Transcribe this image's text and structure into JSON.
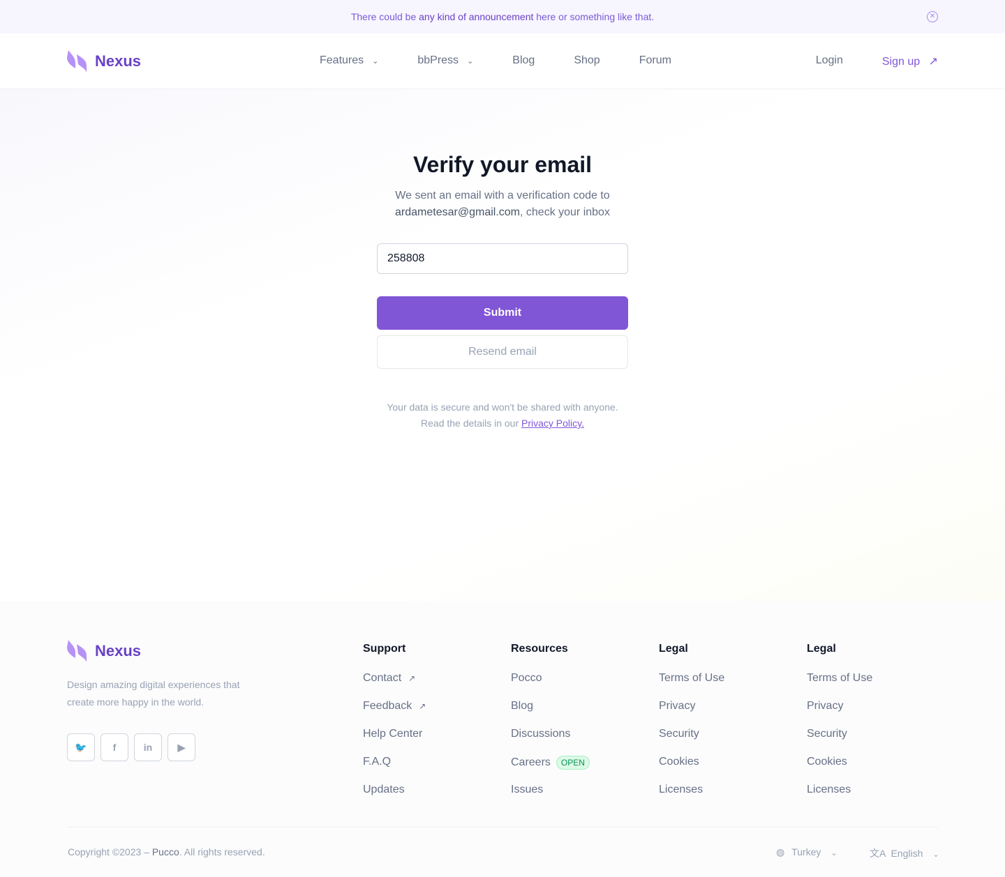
{
  "banner": {
    "pre": "There could be ",
    "bold": "any kind of announcement",
    "post": " here or something like that.",
    "close_icon": "close-circle-icon"
  },
  "brand": {
    "name": "Nexus",
    "color": "#7f56d9"
  },
  "nav": {
    "items": [
      {
        "label": "Features",
        "dropdown": true
      },
      {
        "label": "bbPress",
        "dropdown": true
      },
      {
        "label": "Blog"
      },
      {
        "label": "Shop"
      },
      {
        "label": "Forum"
      }
    ],
    "login": "Login",
    "signup": "Sign up"
  },
  "verify": {
    "title": "Verify your email",
    "line1": "We sent an email with a verification code to",
    "email": "ardametesar@gmail.com",
    "line2": ", check your inbox",
    "code_value": "258808",
    "submit": "Submit",
    "resend": "Resend email",
    "note1": "Your data is secure and won't be shared with anyone.",
    "note2": "Read the details in our ",
    "privacy": "Privacy Policy."
  },
  "footer": {
    "tagline": "Design amazing digital experiences that create more happy in the world.",
    "social": [
      "twitter-icon",
      "facebook-icon",
      "linkedin-icon",
      "youtube-icon"
    ],
    "columns": [
      {
        "title": "Support",
        "links": [
          "Contact",
          "Feedback",
          "Help Center",
          "F.A.Q",
          "Updates"
        ]
      },
      {
        "title": "Resources",
        "links": [
          "Pocco",
          "Blog",
          "Discussions",
          "Careers",
          "Issues"
        ],
        "badge": "OPEN"
      },
      {
        "title": "Legal",
        "links": [
          "Terms of Use",
          "Privacy",
          "Security",
          "Cookies",
          "Licenses"
        ]
      },
      {
        "title": "Legal",
        "links": [
          "Terms of Use",
          "Privacy",
          "Security",
          "Cookies",
          "Licenses"
        ]
      }
    ],
    "copyright_pre": "Copyright ©2023 – ",
    "company": "Pucco",
    "copyright_post": ". All rights reserved.",
    "country": "Turkey",
    "language": "English"
  }
}
